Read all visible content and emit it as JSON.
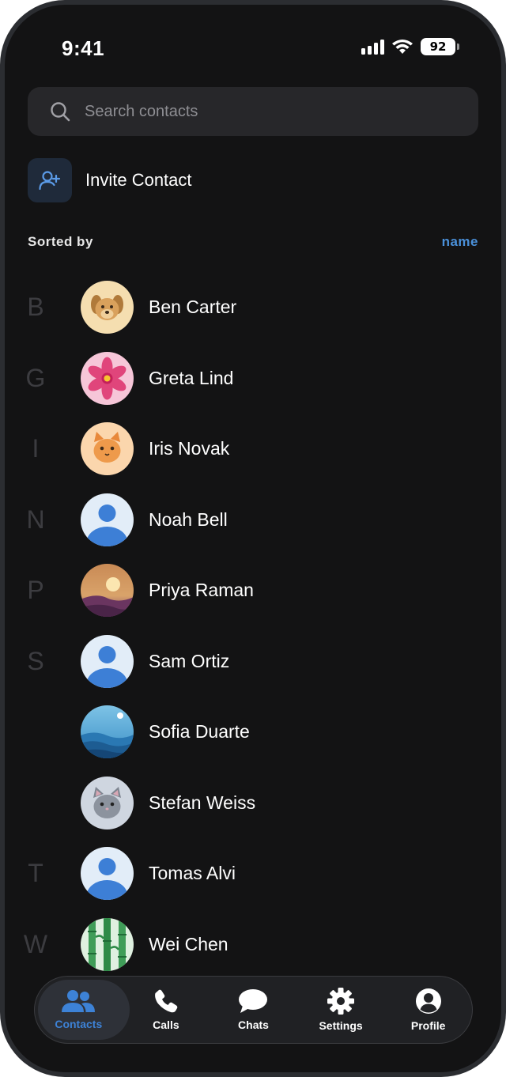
{
  "status_bar": {
    "time": "9:41",
    "battery": "92"
  },
  "search": {
    "placeholder": "Search contacts",
    "value": ""
  },
  "invite": {
    "label": "Invite Contact"
  },
  "sort": {
    "label": "Sorted by",
    "value": "name"
  },
  "contacts": [
    {
      "letter": "B",
      "name": "Ben Carter",
      "avatar": "dog-avatar"
    },
    {
      "letter": "G",
      "name": "Greta Lind",
      "avatar": "flower-avatar"
    },
    {
      "letter": "I",
      "name": "Iris Novak",
      "avatar": "cat-avatar"
    },
    {
      "letter": "N",
      "name": "Noah Bell",
      "avatar": "default-person-avatar"
    },
    {
      "letter": "P",
      "name": "Priya Raman",
      "avatar": "sunset-avatar"
    },
    {
      "letter": "S",
      "name": "Sam Ortiz",
      "avatar": "default-person-avatar"
    },
    {
      "letter": "",
      "name": "Sofia Duarte",
      "avatar": "ocean-avatar"
    },
    {
      "letter": "",
      "name": "Stefan Weiss",
      "avatar": "gray-cat-avatar"
    },
    {
      "letter": "T",
      "name": "Tomas Alvi",
      "avatar": "default-person-avatar"
    },
    {
      "letter": "W",
      "name": "Wei Chen",
      "avatar": "bamboo-avatar"
    }
  ],
  "tabs": [
    {
      "label": "Contacts",
      "icon": "people-icon",
      "active": true
    },
    {
      "label": "Calls",
      "icon": "phone-icon",
      "active": false
    },
    {
      "label": "Chats",
      "icon": "chat-bubble-icon",
      "active": false
    },
    {
      "label": "Settings",
      "icon": "gear-icon",
      "active": false
    },
    {
      "label": "Profile",
      "icon": "person-circle-icon",
      "active": false
    }
  ],
  "colors": {
    "accent": "#3d82d6",
    "background": "#131314",
    "surface": "#27272a"
  }
}
